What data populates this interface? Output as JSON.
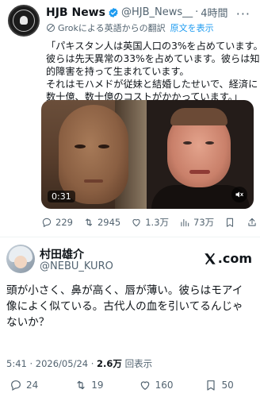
{
  "top_tweet": {
    "author_name": "HJB News",
    "handle": "@HJB_News__",
    "separator": "·",
    "time": "4時間",
    "more": "···",
    "translation_note": "Grokによる英語からの翻訳",
    "show_original": "原文を表示",
    "text_lines": [
      "「パキスタン人は英国人口の3%を占めています。",
      "彼らは先天異常の33%を占めています。彼らは知",
      "的障害を持って生まれています。",
      "それはモハメドが従妹と結婚したせいで、経済に",
      "数十億、数十億のコストがかかっています。」"
    ],
    "video_time": "0:31",
    "actions": {
      "replies": "229",
      "reposts": "2945",
      "likes": "1.3万",
      "views": "73万"
    }
  },
  "bottom_tweet": {
    "author_name": "村田雄介",
    "handle": "@NEBU_KURO",
    "site_label": ".com",
    "text_lines": [
      "頭が小さく、鼻が高く、唇が薄い。彼らはモアイ",
      "像によく似ている。古代人の血を引いてるんじゃ",
      "ないか？"
    ],
    "meta_time": "5:41 · 2026/05/24 · ",
    "meta_views": "2.6万",
    "meta_views_label": " 回表示",
    "actions": {
      "replies": "24",
      "reposts": "19",
      "likes": "160",
      "bookmarks": "50"
    }
  },
  "colors": {
    "verified": "#1d9bf0",
    "link": "#1d9bf0",
    "muted_text": "#536471"
  }
}
